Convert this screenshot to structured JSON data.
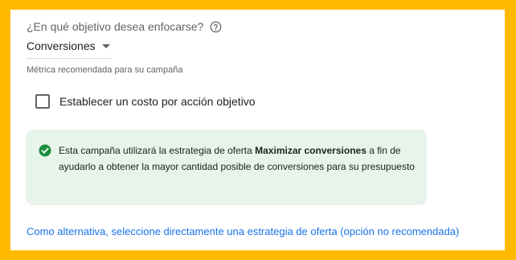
{
  "objective": {
    "question": "¿En qué objetivo desea enfocarse?",
    "help_icon": "help-circle-icon",
    "selected_value": "Conversiones",
    "dropdown_icon": "triangle-down-icon",
    "helper_text": "Métrica recomendada para su campaña"
  },
  "cpa": {
    "label": "Establecer un costo por acción objetivo",
    "checked": false
  },
  "info": {
    "icon": "check-circle-icon",
    "icon_color": "#1e8e3e",
    "background": "#e6f4ea",
    "text_before": "Esta campaña utilizará la estrategia de oferta ",
    "text_bold": "Maximizar conversiones",
    "text_after": " a fin de ayudarlo a obtener la mayor cantidad posible de conversiones para su presupuesto"
  },
  "alternative_link": {
    "label": "Como alternativa, seleccione directamente una estrategia de oferta (opción no recomendada)",
    "color": "#1a73e8"
  }
}
